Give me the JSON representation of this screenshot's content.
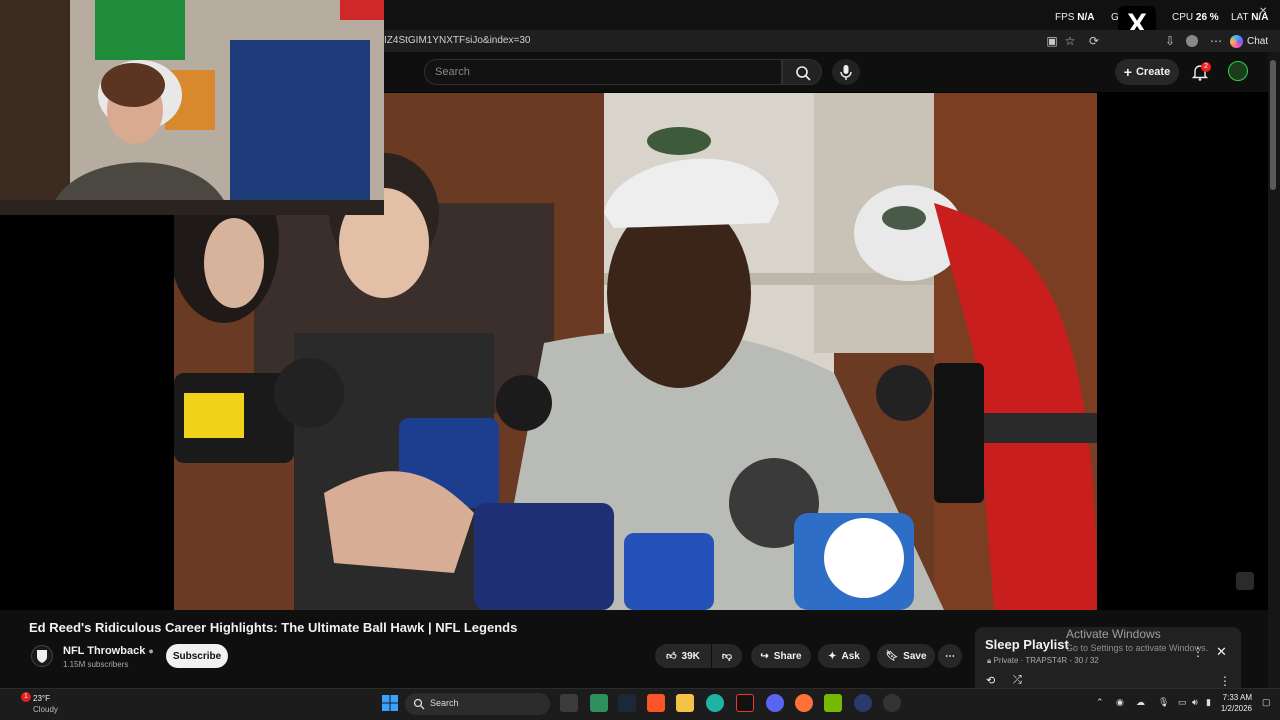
{
  "overlay": {
    "fps_label": "FPS",
    "fps_value": "N/A",
    "gpu_label": "G",
    "cpu_label": "CPU",
    "cpu_value": "26 %",
    "lat_label": "LAT",
    "lat_value": "N/A"
  },
  "browser": {
    "url": "IZ4StGIM1YNXTFsiJo&index=30",
    "chat_label": "Chat"
  },
  "youtube": {
    "search_placeholder": "Search",
    "create_label": "Create",
    "notification_count": "2"
  },
  "video": {
    "title": "Ed Reed's Ridiculous Career Highlights: The Ultimate Ball Hawk | NFL Legends",
    "channel": "NFL Throwback",
    "subscribers": "1.15M subscribers",
    "subscribe_label": "Subscribe",
    "like_count": "39K",
    "share_label": "Share",
    "ask_label": "Ask",
    "save_label": "Save"
  },
  "playlist": {
    "title": "Sleep Playlist",
    "privacy": "Private",
    "owner": "TRAPST4R",
    "position": "30 / 32"
  },
  "watermark": {
    "line1": "Activate Windows",
    "line2": "Go to Settings to activate Windows."
  },
  "taskbar": {
    "temperature": "23°F",
    "condition": "Cloudy",
    "weather_badge": "1",
    "search_label": "Search",
    "time": "7:33 AM",
    "date": "1/2/2026"
  },
  "colors": {
    "youtube_bg": "#0f0f0f",
    "notif_red": "#e22222",
    "locker_wood": "#7a4226"
  }
}
